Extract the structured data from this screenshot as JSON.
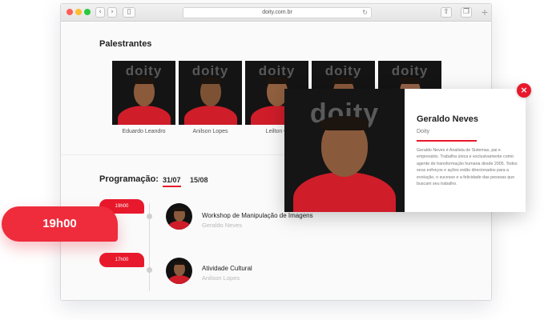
{
  "browser": {
    "url": "doity.com.br",
    "icons": {
      "back": "chevron-left-icon",
      "forward": "chevron-right-icon",
      "sidebar": "sidebar-icon",
      "reload": "reload-icon",
      "share": "share-icon",
      "tabs": "tabs-icon",
      "new_tab": "plus-icon"
    }
  },
  "speakers_section": {
    "title": "Palestrantes",
    "logo_text": "doity",
    "speakers": [
      {
        "name": "Eduardo Leandro"
      },
      {
        "name": "Anilson Lopes"
      },
      {
        "name": "Leilton C"
      },
      {
        "name": ""
      },
      {
        "name": ""
      }
    ]
  },
  "schedule": {
    "title": "Programação:",
    "dates": [
      "31/07",
      "15/08"
    ],
    "active_date": "31/07",
    "events": [
      {
        "time": "19h00",
        "title": "Workshop de Manipulação de Imagens",
        "speaker": "Geraldo Neves"
      },
      {
        "time": "17h00",
        "title": "Atividade Cultural",
        "speaker": "Anilson Lopes"
      }
    ]
  },
  "popup": {
    "name": "Geraldo Neves",
    "organization": "Doity",
    "logo_text": "doity",
    "bio": "Geraldo Neves é Analista de Sistemas, pai e empresário. Trabalha única e exclusivamente como agente de transformação humana desde 2005. Todos seus esforços e ações estão direcionados para a evolução, o sucesso e a felicidade das pessoas que buscam seu trabalho.",
    "close_label": "×"
  },
  "floating_time": "19h00",
  "colors": {
    "accent": "#e8192c",
    "shirt": "#cf1d2a",
    "photo_bg": "#141414"
  }
}
